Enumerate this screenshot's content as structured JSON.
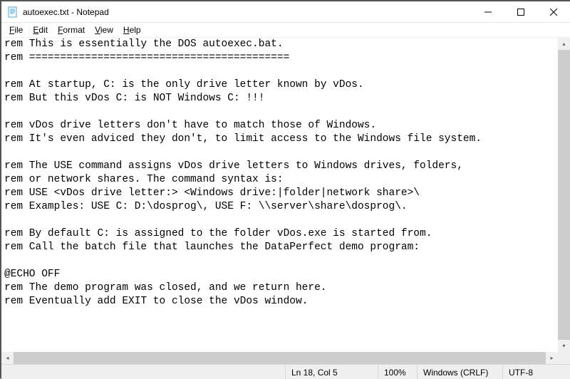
{
  "window": {
    "title": "autoexec.txt - Notepad"
  },
  "menu": {
    "file": "File",
    "edit": "Edit",
    "format": "Format",
    "view": "View",
    "help": "Help"
  },
  "editor": {
    "lines": [
      "rem This is essentially the DOS autoexec.bat.",
      "rem ==========================================",
      "",
      "rem At startup, C: is the only drive letter known by vDos.",
      "rem But this vDos C: is NOT Windows C: !!!",
      "",
      "rem vDos drive letters don't have to match those of Windows.",
      "rem It's even adviced they don't, to limit access to the Windows file system.",
      "",
      "rem The USE command assigns vDos drive letters to Windows drives, folders,",
      "rem or network shares. The command syntax is:",
      "rem USE <vDos drive letter:> <Windows drive:|folder|network share>\\",
      "rem Examples: USE C: D:\\dosprog\\, USE F: \\\\server\\share\\dosprog\\.",
      "",
      "rem By default C: is assigned to the folder vDos.exe is started from.",
      "rem Call the batch file that launches the DataPerfect demo program:",
      "",
      "@ECHO OFF",
      "rem The demo program was closed, and we return here.",
      "rem Eventually add EXIT to close the vDos window."
    ]
  },
  "status": {
    "position": "Ln 18, Col 5",
    "zoom": "100%",
    "line_ending": "Windows (CRLF)",
    "encoding": "UTF-8"
  },
  "scroll": {
    "v_thumb_top_pct": 0,
    "v_thumb_height_pct": 100,
    "h_thumb_left_pct": 0,
    "h_thumb_width_pct": 100
  }
}
